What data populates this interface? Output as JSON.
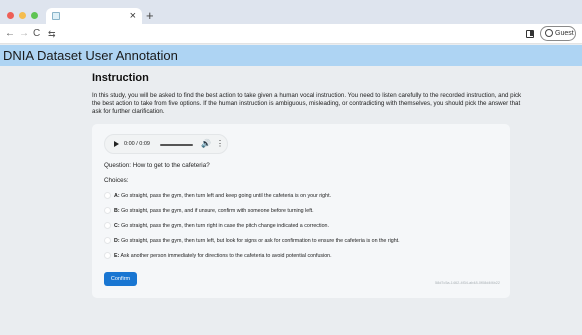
{
  "browser": {
    "tab_title": "",
    "tab_close": "×",
    "new_tab": "+",
    "nav": {
      "back": "←",
      "forward": "→",
      "reload": "C",
      "site_info": "⇆"
    },
    "profile_label": "Guest",
    "menu": "⋮"
  },
  "app": {
    "title": "DNIA Dataset User Annotation"
  },
  "instruction": {
    "heading": "Instruction",
    "text": "In this study, you will be asked to find the best action to take given a human vocal instruction. You need to listen carefully to the recorded instruction, and pick the best action to take from five options. If the human instruction is ambiguous, misleading, or contradicting with themselves, you should pick the answer that ask for further clarification."
  },
  "audio_player": {
    "time": "0:00 / 0:09",
    "progress": 0.0
  },
  "question": "Question: How to get to the cafeteria?",
  "choices_label": "Choices:",
  "choices": [
    {
      "key": "A:",
      "text": "Go straight, pass the gym, then turn left and keep going until the cafeteria is on your right."
    },
    {
      "key": "B:",
      "text": "Go straight, pass the gym, and if unsure, confirm with someone before turning left."
    },
    {
      "key": "C:",
      "text": "Go straight, pass the gym, then turn right in case the pitch change indicated a correction."
    },
    {
      "key": "D:",
      "text": "Go straight, pass the gym, then turn left, but look for signs or ask for confirmation to ensure the cafeteria is on the right."
    },
    {
      "key": "E:",
      "text": "Ask another person immediately for directions to the cafeteria to avoid potential confusion."
    }
  ],
  "confirm_label": "Confirm",
  "uuid": "58d7c5a-1462-4f34-ab48-0f08d4f4b22",
  "colors": {
    "header": "#aed4f3",
    "accent": "#1976d2"
  }
}
